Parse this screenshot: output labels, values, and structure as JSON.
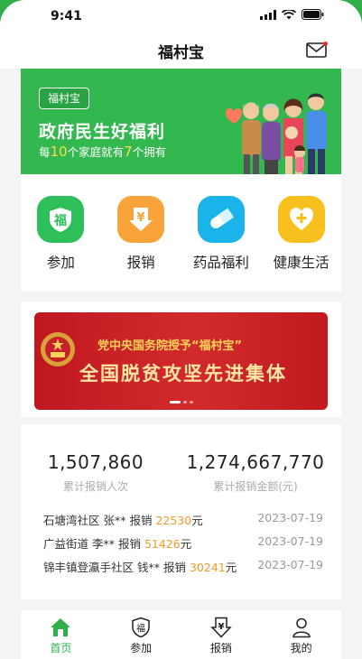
{
  "status_bar": {
    "time": "9:41"
  },
  "header": {
    "title": "福村宝"
  },
  "banner": {
    "tag": "福村宝",
    "title": "政府民生好福利",
    "subtitle_parts": [
      "每",
      "10",
      "个家庭就有",
      "7",
      "个拥有"
    ]
  },
  "services": [
    {
      "label": "参加",
      "icon": "fu-shield-icon",
      "color": "#2fbf5a"
    },
    {
      "label": "报销",
      "icon": "yen-download-icon",
      "color": "#f9a43a"
    },
    {
      "label": "药品福利",
      "icon": "pill-icon",
      "color": "#1ab3ea"
    },
    {
      "label": "健康生活",
      "icon": "heart-plus-icon",
      "color": "#f7c01f"
    }
  ],
  "promo": {
    "line1": "党中央国务院授予“福村宝”",
    "line2": "全国脱贫攻坚先进集体"
  },
  "stats": {
    "count_value": "1,507,860",
    "count_label": "累计报销人次",
    "amount_value": "1,274,667,770",
    "amount_label": "累计报销金额(元)"
  },
  "records": [
    {
      "place": "石塘湾社区 张**",
      "action": "报销",
      "amount": "22530",
      "unit": "元",
      "date": "2023-07-19"
    },
    {
      "place": "广益街道 李**",
      "action": "报销",
      "amount": "51426",
      "unit": "元",
      "date": "2023-07-19"
    },
    {
      "place": "锦丰镇登瀛手社区 钱**",
      "action": "报销",
      "amount": "30241",
      "unit": "元",
      "date": "2023-07-19"
    }
  ],
  "tabbar": [
    {
      "label": "首页",
      "icon": "home-icon",
      "active": true
    },
    {
      "label": "参加",
      "icon": "fu-shield-icon",
      "active": false
    },
    {
      "label": "报销",
      "icon": "yen-download-icon",
      "active": false
    },
    {
      "label": "我的",
      "icon": "user-icon",
      "active": false
    }
  ],
  "colors": {
    "primary": "#2fae4a",
    "amount": "#f19a2a",
    "promo_red": "#c8202a"
  }
}
